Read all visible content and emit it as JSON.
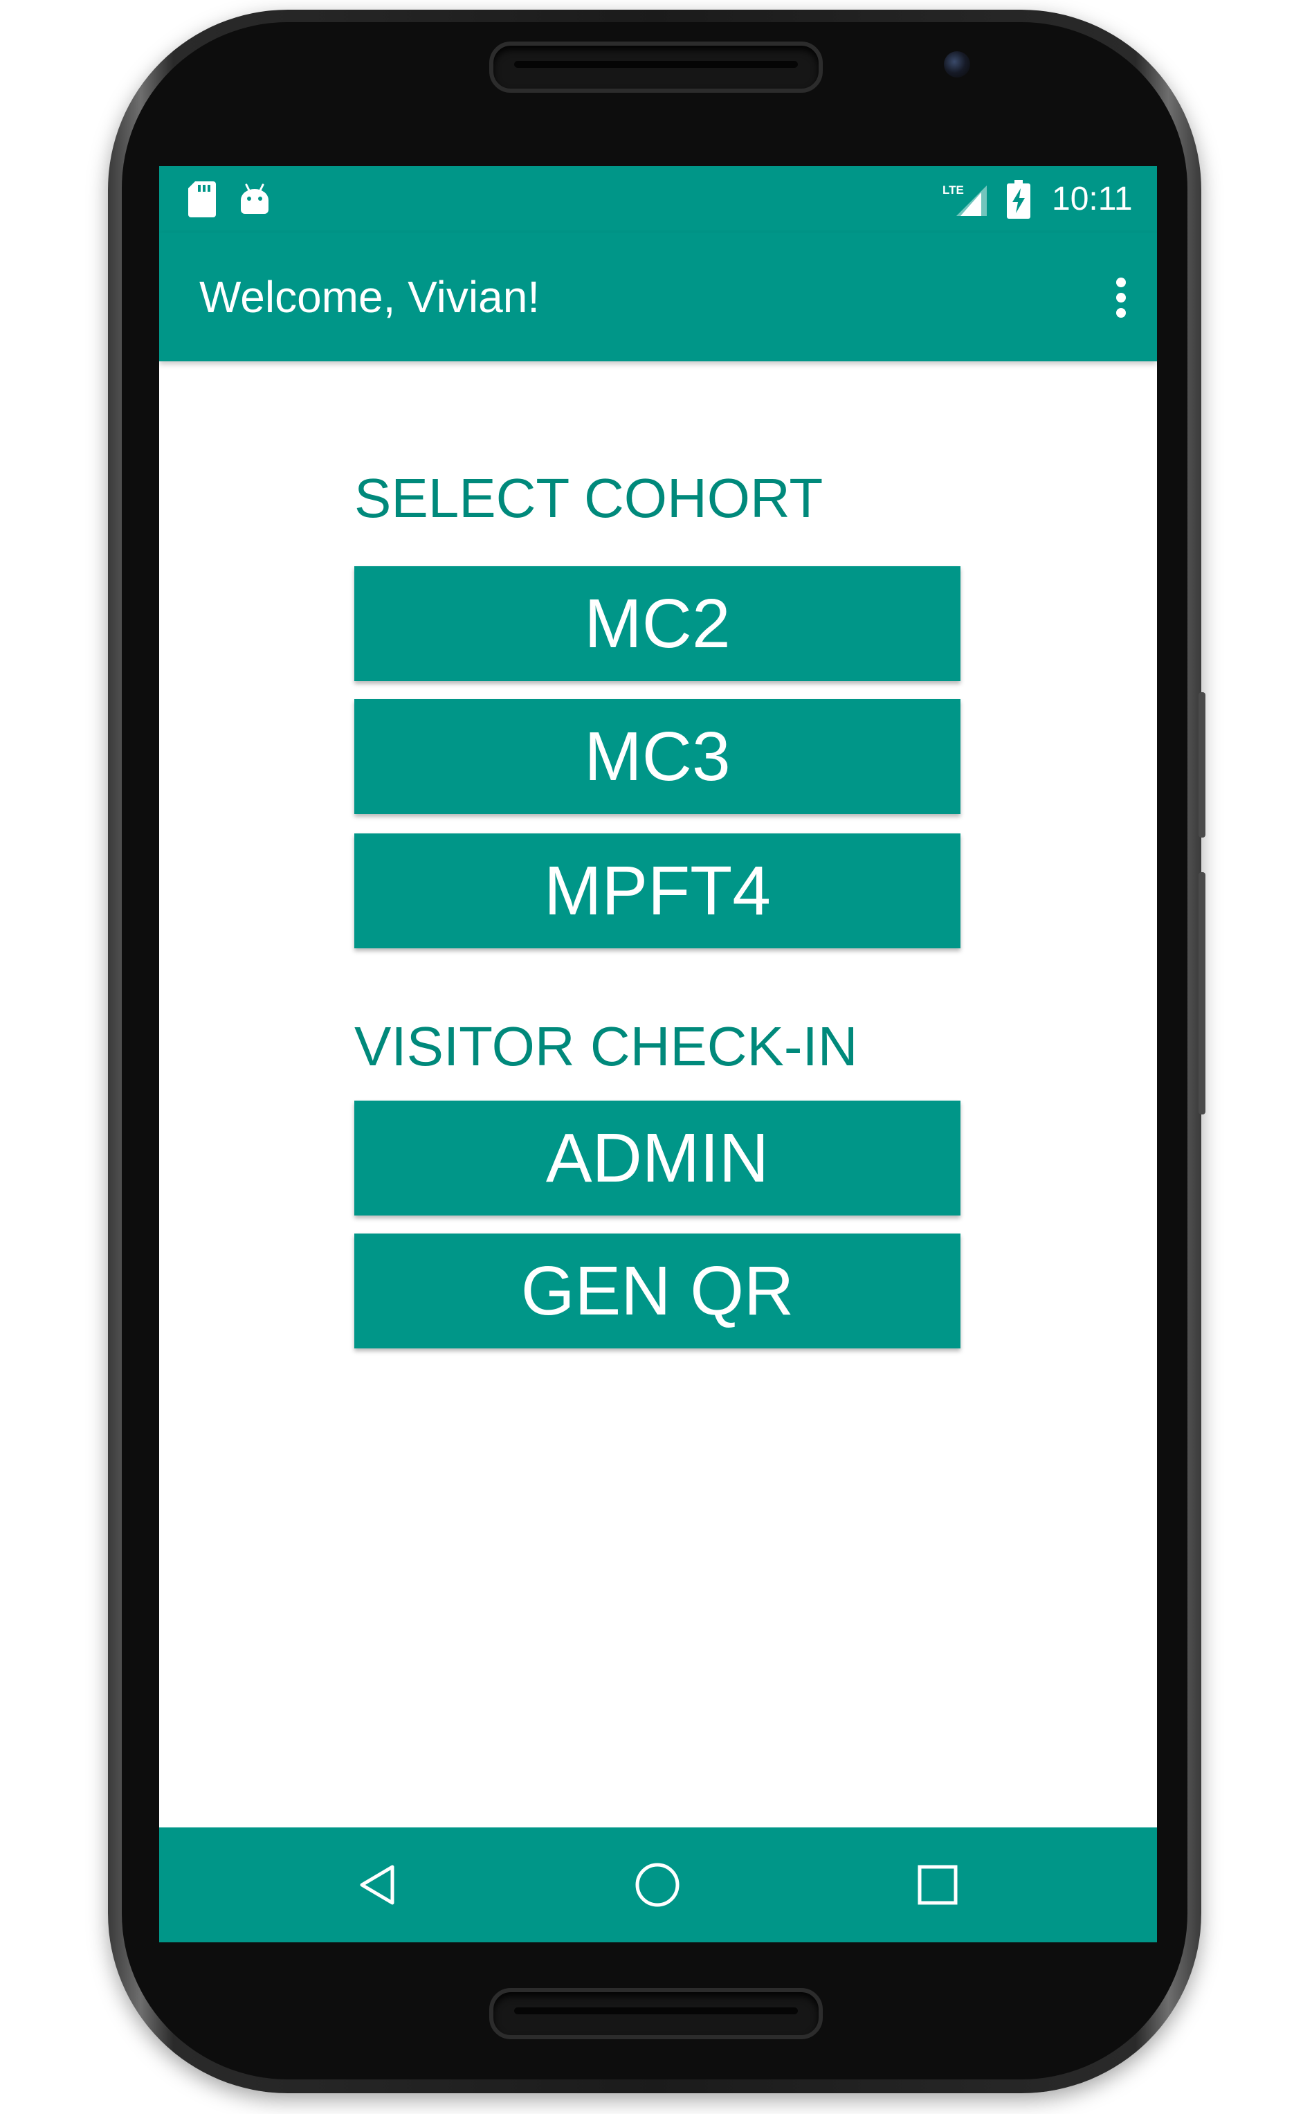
{
  "status_bar": {
    "network": "LTE",
    "time": "10:11"
  },
  "app_bar": {
    "title": "Welcome, Vivian!"
  },
  "cohort_section": {
    "heading": "SELECT COHORT",
    "buttons": [
      "MC2",
      "MC3",
      "MPFT4"
    ]
  },
  "visitor_section": {
    "heading": "VISITOR CHECK-IN",
    "buttons": [
      "ADMIN",
      "GEN QR"
    ]
  },
  "icons": {
    "sd_card": "sd-card-icon",
    "android": "android-debug-icon",
    "signal": "lte-signal-icon",
    "battery": "battery-charging-icon",
    "overflow": "more-vert-icon",
    "back": "back-triangle-icon",
    "home": "home-circle-icon",
    "recents": "recents-square-icon"
  },
  "colors": {
    "primary": "#009688",
    "heading_text": "#00897b",
    "on_primary": "#ffffff",
    "background": "#ffffff"
  }
}
